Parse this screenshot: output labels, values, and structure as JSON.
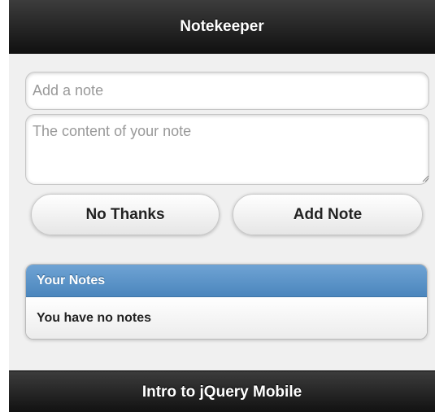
{
  "header": {
    "title": "Notekeeper"
  },
  "form": {
    "title_placeholder": "Add a note",
    "content_placeholder": "The content of your note"
  },
  "buttons": {
    "cancel_label": "No Thanks",
    "add_label": "Add Note"
  },
  "notes": {
    "divider_label": "Your Notes",
    "empty_message": "You have no notes"
  },
  "footer": {
    "title": "Intro to jQuery Mobile"
  },
  "colors": {
    "bar": "#1e1e1e",
    "divider": "#5a93c8",
    "page_bg": "#f0f0f0"
  }
}
